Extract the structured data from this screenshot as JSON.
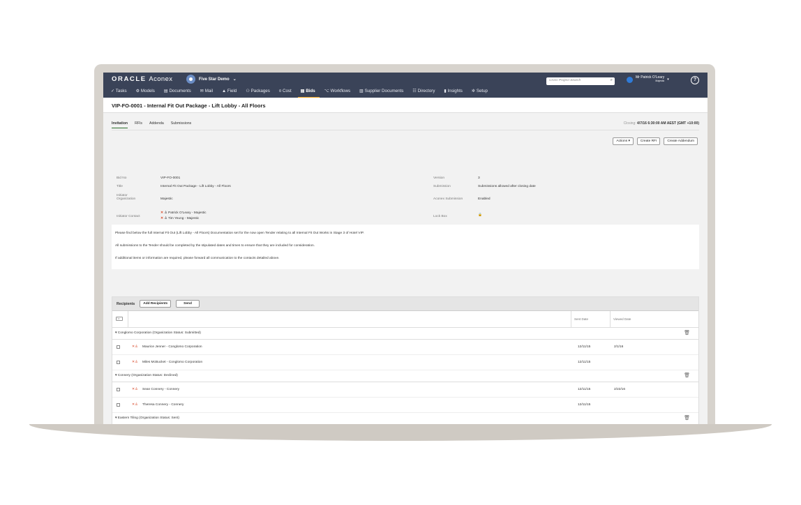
{
  "app": {
    "brand_bold": "ORACLE",
    "brand_light": "Aconex",
    "project": "Five Star Demo",
    "search_placeholder": "Cross Project Search",
    "user_name": "Mr Patrick O'Leary",
    "user_org": "Majestic",
    "help": "?"
  },
  "nav": [
    {
      "icon": "✓",
      "label": "Tasks"
    },
    {
      "icon": "⚙",
      "label": "Models"
    },
    {
      "icon": "▤",
      "label": "Documents"
    },
    {
      "icon": "✉",
      "label": "Mail"
    },
    {
      "icon": "▲",
      "label": "Field"
    },
    {
      "icon": "⚇",
      "label": "Packages"
    },
    {
      "icon": "¤",
      "label": "Cost"
    },
    {
      "icon": "▤",
      "label": "Bids"
    },
    {
      "icon": "⌥",
      "label": "Workflows"
    },
    {
      "icon": "▥",
      "label": "Supplier Documents"
    },
    {
      "icon": "☷",
      "label": "Directory"
    },
    {
      "icon": "▮",
      "label": "Insights"
    },
    {
      "icon": "✲",
      "label": "Setup"
    }
  ],
  "page_title": "VIP-FO-0001 - Internal Fit Out Package - Lift Lobby - All Floors",
  "tabs": [
    "Invitation",
    "RFIs",
    "Addenda",
    "Submissions"
  ],
  "closing_label": "Closing:",
  "closing_value": "4/7/16 6:30:00 AM AEST (GMT +10:00)",
  "actions": {
    "actions": "Actions ▾",
    "create_rfi": "Create RFI",
    "create_addendum": "Create Addendum"
  },
  "details": {
    "bid_no_label": "Bid No",
    "bid_no": "VIP-FO-0001",
    "title_label": "Title",
    "title": "Internal Fit Out Package - Lift Lobby - All Floors",
    "org_label_1": "Initiator",
    "org_label_2": "Organization",
    "org": "Majestic",
    "contact_label": "Initiator Contact",
    "contact_1": "Patrick O'Leary - Majestic",
    "contact_2": "Tim Yeung - Majestic",
    "version_label": "Version",
    "version": "3",
    "submission_label": "Submission",
    "submission": "Submissions allowed after closing date",
    "aconex_sub_label": "Aconex Submission",
    "aconex_sub": "Enabled",
    "lockbox_label": "Lock Box",
    "lockbox": "🔒"
  },
  "description": [
    "Please find below the full Internal Fit Out (Lift Lobby - All Floors) Documentation set for the now open Tender relating to all Internal Fit Out Works in Stage 3 of Hotel VIP.",
    "All submissions to the Tender should be completed by the stipulated dates and times to ensure that they are included for consideration.",
    "If additional items or information are required, please forward all communication to the contacts detailed above."
  ],
  "recipients": {
    "title": "Recipients",
    "add_label": "Add Recipients",
    "send_label": "Send",
    "sent_col": "Sent Date",
    "viewed_col": "Viewed Date",
    "groups": [
      {
        "label": "Conglomo Corporation (Organization Status: Submitted)",
        "rows": [
          {
            "name": "Maurice Jenner - Conglomo Corporation",
            "sent": "12/11/15",
            "viewed": "2/1/16"
          },
          {
            "name": "Miles McBucket - Conglomo Corporation",
            "sent": "12/11/15",
            "viewed": ""
          }
        ]
      },
      {
        "label": "Connery (Organization Status: Declined)",
        "rows": [
          {
            "name": "Sean Connery - Connery",
            "sent": "12/11/15",
            "viewed": "2/22/16"
          },
          {
            "name": "Theresa Connery - Connery",
            "sent": "12/11/15",
            "viewed": ""
          }
        ]
      },
      {
        "label": "Eastern Tiling (Organization Status: Sent)",
        "rows": []
      }
    ]
  }
}
